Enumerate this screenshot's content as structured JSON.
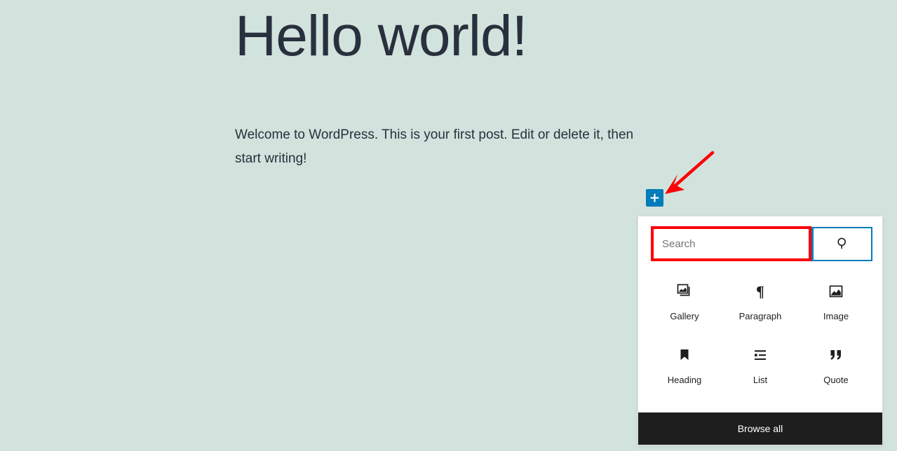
{
  "page": {
    "background_color": "#d2e2dc",
    "text_color": "#28303d"
  },
  "post": {
    "title": "Hello world!",
    "paragraph": "Welcome to WordPress. This is your first post. Edit or delete it, then start writing!"
  },
  "inserter_toggle": {
    "label": "+",
    "icon": "plus-icon",
    "color": "#007cba"
  },
  "annotation": {
    "arrow_color": "#fb0007",
    "highlight_color": "#fb0007",
    "highlight_target": "search-input"
  },
  "inserter": {
    "search": {
      "value": "",
      "placeholder": "Search",
      "submit_icon": "search-icon",
      "border_color": "#007cba"
    },
    "blocks": [
      {
        "label": "Gallery",
        "icon": "gallery-icon"
      },
      {
        "label": "Paragraph",
        "icon": "paragraph-icon"
      },
      {
        "label": "Image",
        "icon": "image-icon"
      },
      {
        "label": "Heading",
        "icon": "heading-bookmark-icon"
      },
      {
        "label": "List",
        "icon": "list-icon"
      },
      {
        "label": "Quote",
        "icon": "quote-icon"
      }
    ],
    "browse_all_label": "Browse all"
  }
}
